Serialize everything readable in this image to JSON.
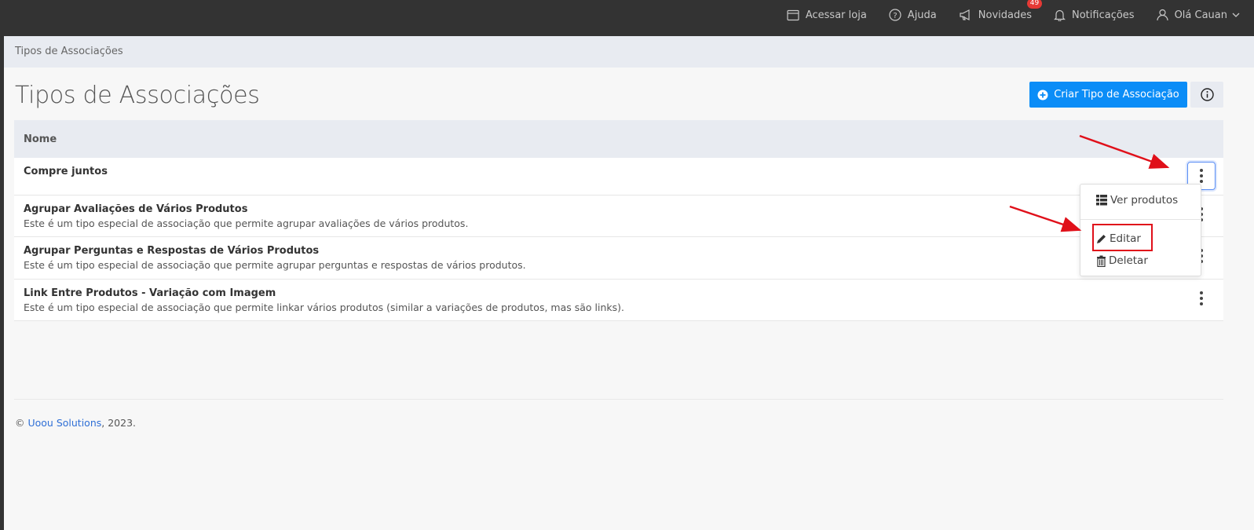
{
  "topnav": {
    "store": "Acessar loja",
    "help": "Ajuda",
    "news": "Novidades",
    "news_badge": "49",
    "notifications": "Notificações",
    "user": "Olá Cauan"
  },
  "breadcrumb": "Tipos de Associações",
  "page_title": "Tipos de Associações",
  "create_button": "Criar Tipo de Associação",
  "table": {
    "header_name": "Nome",
    "rows": [
      {
        "title": "Compre juntos",
        "desc": ""
      },
      {
        "title": "Agrupar Avaliações de Vários Produtos",
        "desc": "Este é um tipo especial de associação que permite agrupar avaliações de vários produtos."
      },
      {
        "title": "Agrupar Perguntas e Respostas de Vários Produtos",
        "desc": "Este é um tipo especial de associação que permite agrupar perguntas e respostas de vários produtos."
      },
      {
        "title": "Link Entre Produtos - Variação com Imagem",
        "desc": "Este é um tipo especial de associação que permite linkar vários produtos (similar a variações de produtos, mas são links)."
      }
    ]
  },
  "dropdown": {
    "view_products": "Ver produtos",
    "edit": "Editar",
    "delete": "Deletar"
  },
  "footer": {
    "copyright": "©",
    "company": "Uoou Solutions",
    "year": ", 2023."
  },
  "colors": {
    "primary": "#0b8df7",
    "annotation": "#e0101a",
    "topbar": "#333333",
    "link": "#2f6fd6"
  }
}
